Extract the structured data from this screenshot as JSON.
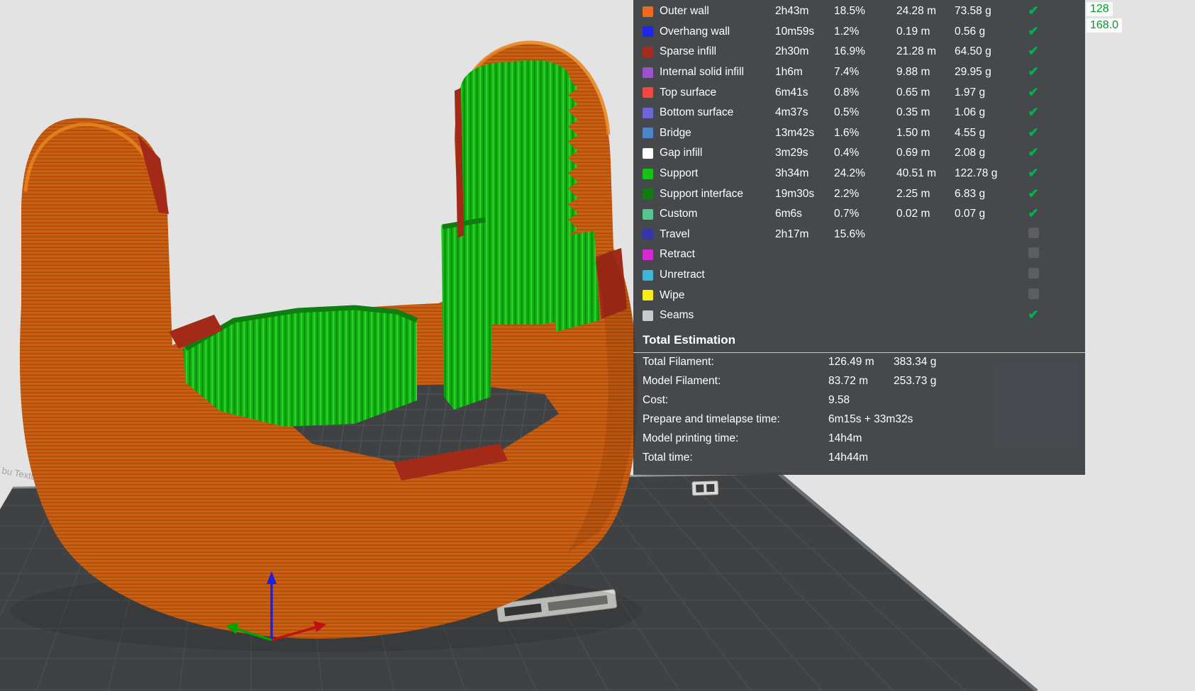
{
  "viewport": {
    "plate_text_fragment": "bu Textu"
  },
  "corner": {
    "value1": "128",
    "value2": "168.0",
    "text_color": "#009B2A"
  },
  "panel": {
    "check_color": "#00B34A",
    "rows": [
      {
        "label": "Outer wall",
        "color": "#ED6B21",
        "time": "2h43m",
        "percent": "18.5%",
        "length": "24.28 m",
        "weight": "73.58 g",
        "checked": true
      },
      {
        "label": "Overhang wall",
        "color": "#2026E8",
        "time": "10m59s",
        "percent": "1.2%",
        "length": "0.19 m",
        "weight": "0.56 g",
        "checked": true
      },
      {
        "label": "Sparse infill",
        "color": "#A42B22",
        "time": "2h30m",
        "percent": "16.9%",
        "length": "21.28 m",
        "weight": "64.50 g",
        "checked": true
      },
      {
        "label": "Internal solid infill",
        "color": "#9B52CE",
        "time": "1h6m",
        "percent": "7.4%",
        "length": "9.88 m",
        "weight": "29.95 g",
        "checked": true
      },
      {
        "label": "Top surface",
        "color": "#F24840",
        "time": "6m41s",
        "percent": "0.8%",
        "length": "0.65 m",
        "weight": "1.97 g",
        "checked": true
      },
      {
        "label": "Bottom surface",
        "color": "#6D66D6",
        "time": "4m37s",
        "percent": "0.5%",
        "length": "0.35 m",
        "weight": "1.06 g",
        "checked": true
      },
      {
        "label": "Bridge",
        "color": "#4E85C8",
        "time": "13m42s",
        "percent": "1.6%",
        "length": "1.50 m",
        "weight": "4.55 g",
        "checked": true
      },
      {
        "label": "Gap infill",
        "color": "#FFFFFF",
        "time": "3m29s",
        "percent": "0.4%",
        "length": "0.69 m",
        "weight": "2.08 g",
        "checked": true
      },
      {
        "label": "Support",
        "color": "#16C218",
        "time": "3h34m",
        "percent": "24.2%",
        "length": "40.51 m",
        "weight": "122.78 g",
        "checked": true
      },
      {
        "label": "Support interface",
        "color": "#147A14",
        "time": "19m30s",
        "percent": "2.2%",
        "length": "2.25 m",
        "weight": "6.83 g",
        "checked": true
      },
      {
        "label": "Custom",
        "color": "#58C48F",
        "time": "6m6s",
        "percent": "0.7%",
        "length": "0.02 m",
        "weight": "0.07 g",
        "checked": true
      },
      {
        "label": "Travel",
        "color": "#3436AE",
        "time": "2h17m",
        "percent": "15.6%",
        "length": "",
        "weight": "",
        "checked": false
      },
      {
        "label": "Retract",
        "color": "#D629D6",
        "time": "",
        "percent": "",
        "length": "",
        "weight": "",
        "checked": false
      },
      {
        "label": "Unretract",
        "color": "#3FB5D8",
        "time": "",
        "percent": "",
        "length": "",
        "weight": "",
        "checked": false
      },
      {
        "label": "Wipe",
        "color": "#F5EE18",
        "time": "",
        "percent": "",
        "length": "",
        "weight": "",
        "checked": false
      },
      {
        "label": "Seams",
        "color": "#CACACE",
        "time": "",
        "percent": "",
        "length": "",
        "weight": "",
        "checked": true
      }
    ],
    "total": {
      "title": "Total Estimation",
      "lines": [
        {
          "label": "Total Filament:",
          "value": "126.49 m",
          "value2": "383.34 g"
        },
        {
          "label": "Model Filament:",
          "value": "83.72 m",
          "value2": "253.73 g"
        },
        {
          "label": "Cost:",
          "value": "9.58",
          "value2": ""
        },
        {
          "label": "Prepare and timelapse time:",
          "value": "6m15s + 33m32s",
          "value2": ""
        },
        {
          "label": "Model printing time:",
          "value": "14h4m",
          "value2": ""
        },
        {
          "label": "Total time:",
          "value": "14h44m",
          "value2": ""
        }
      ]
    }
  },
  "colors": {
    "model": "#CB5E12",
    "model_dark": "#A84F0B",
    "support": "#12B512",
    "support_dark": "#0C8E0C",
    "support_light": "#3ADB3A",
    "support_interface": "#0E7E10",
    "accent_red": "#A32A18",
    "plate": "#3F4143",
    "plate_grid": "#4C4F52",
    "background": "#E3E3E4"
  }
}
